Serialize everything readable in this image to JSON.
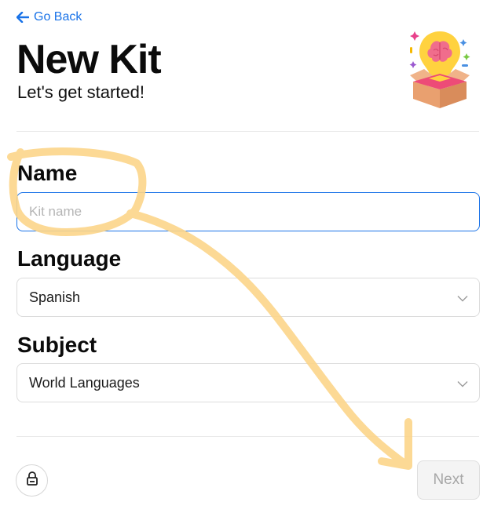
{
  "nav": {
    "back_label": "Go Back"
  },
  "header": {
    "title": "New Kit",
    "subtitle": "Let's get started!"
  },
  "form": {
    "name": {
      "label": "Name",
      "placeholder": "Kit name",
      "value": ""
    },
    "language": {
      "label": "Language",
      "selected": "Spanish"
    },
    "subject": {
      "label": "Subject",
      "selected": "World Languages"
    }
  },
  "footer": {
    "next_label": "Next"
  },
  "icons": {
    "back": "arrow-left-icon",
    "lock": "lock-icon",
    "chevron": "chevron-down-icon",
    "illustration": "brain-lightbulb-box-illustration"
  },
  "colors": {
    "accent": "#1a73e8",
    "annotation": "#fcd58a",
    "disabled_button_bg": "#f4f4f4",
    "disabled_button_text": "#a7a7a7"
  }
}
